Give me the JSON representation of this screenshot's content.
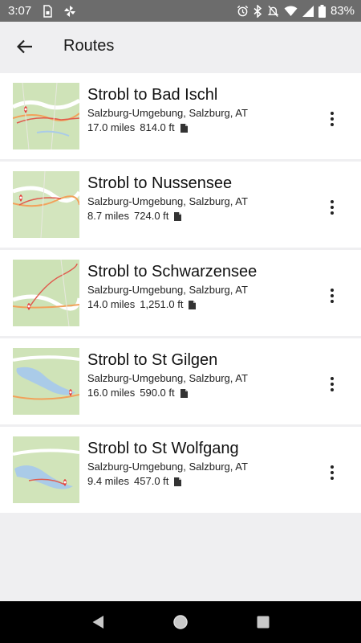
{
  "status_bar": {
    "time": "3:07",
    "battery": "83%",
    "left_icons": [
      "sim-card-icon",
      "pinwheel-icon"
    ],
    "right_icons": [
      "alarm-icon",
      "bluetooth-icon",
      "mute-icon",
      "wifi-icon",
      "signal-icon",
      "battery-icon"
    ]
  },
  "app_bar": {
    "back_icon": "arrow-left-icon",
    "title": "Routes"
  },
  "routes": [
    {
      "title": "Strobl to Bad Ischl",
      "location": "Salzburg-Umgebung, Salzburg, AT",
      "distance": "17.0 miles",
      "elevation": "814.0 ft"
    },
    {
      "title": "Strobl to Nussensee",
      "location": "Salzburg-Umgebung, Salzburg, AT",
      "distance": "8.7 miles",
      "elevation": "724.0 ft"
    },
    {
      "title": "Strobl to Schwarzensee",
      "location": "Salzburg-Umgebung, Salzburg, AT",
      "distance": "14.0 miles",
      "elevation": "1,251.0 ft"
    },
    {
      "title": "Strobl to St Gilgen",
      "location": "Salzburg-Umgebung, Salzburg, AT",
      "distance": "16.0 miles",
      "elevation": "590.0 ft"
    },
    {
      "title": "Strobl to St Wolfgang",
      "location": "Salzburg-Umgebung, Salzburg, AT",
      "distance": "9.4 miles",
      "elevation": "457.0 ft"
    }
  ],
  "colors": {
    "map_green": "#c9dfb0",
    "map_road": "#f2a15a",
    "map_water": "#aacbe8",
    "pin": "#e53935"
  },
  "nav_bar": [
    "back-triangle-icon",
    "home-circle-icon",
    "recents-square-icon"
  ]
}
